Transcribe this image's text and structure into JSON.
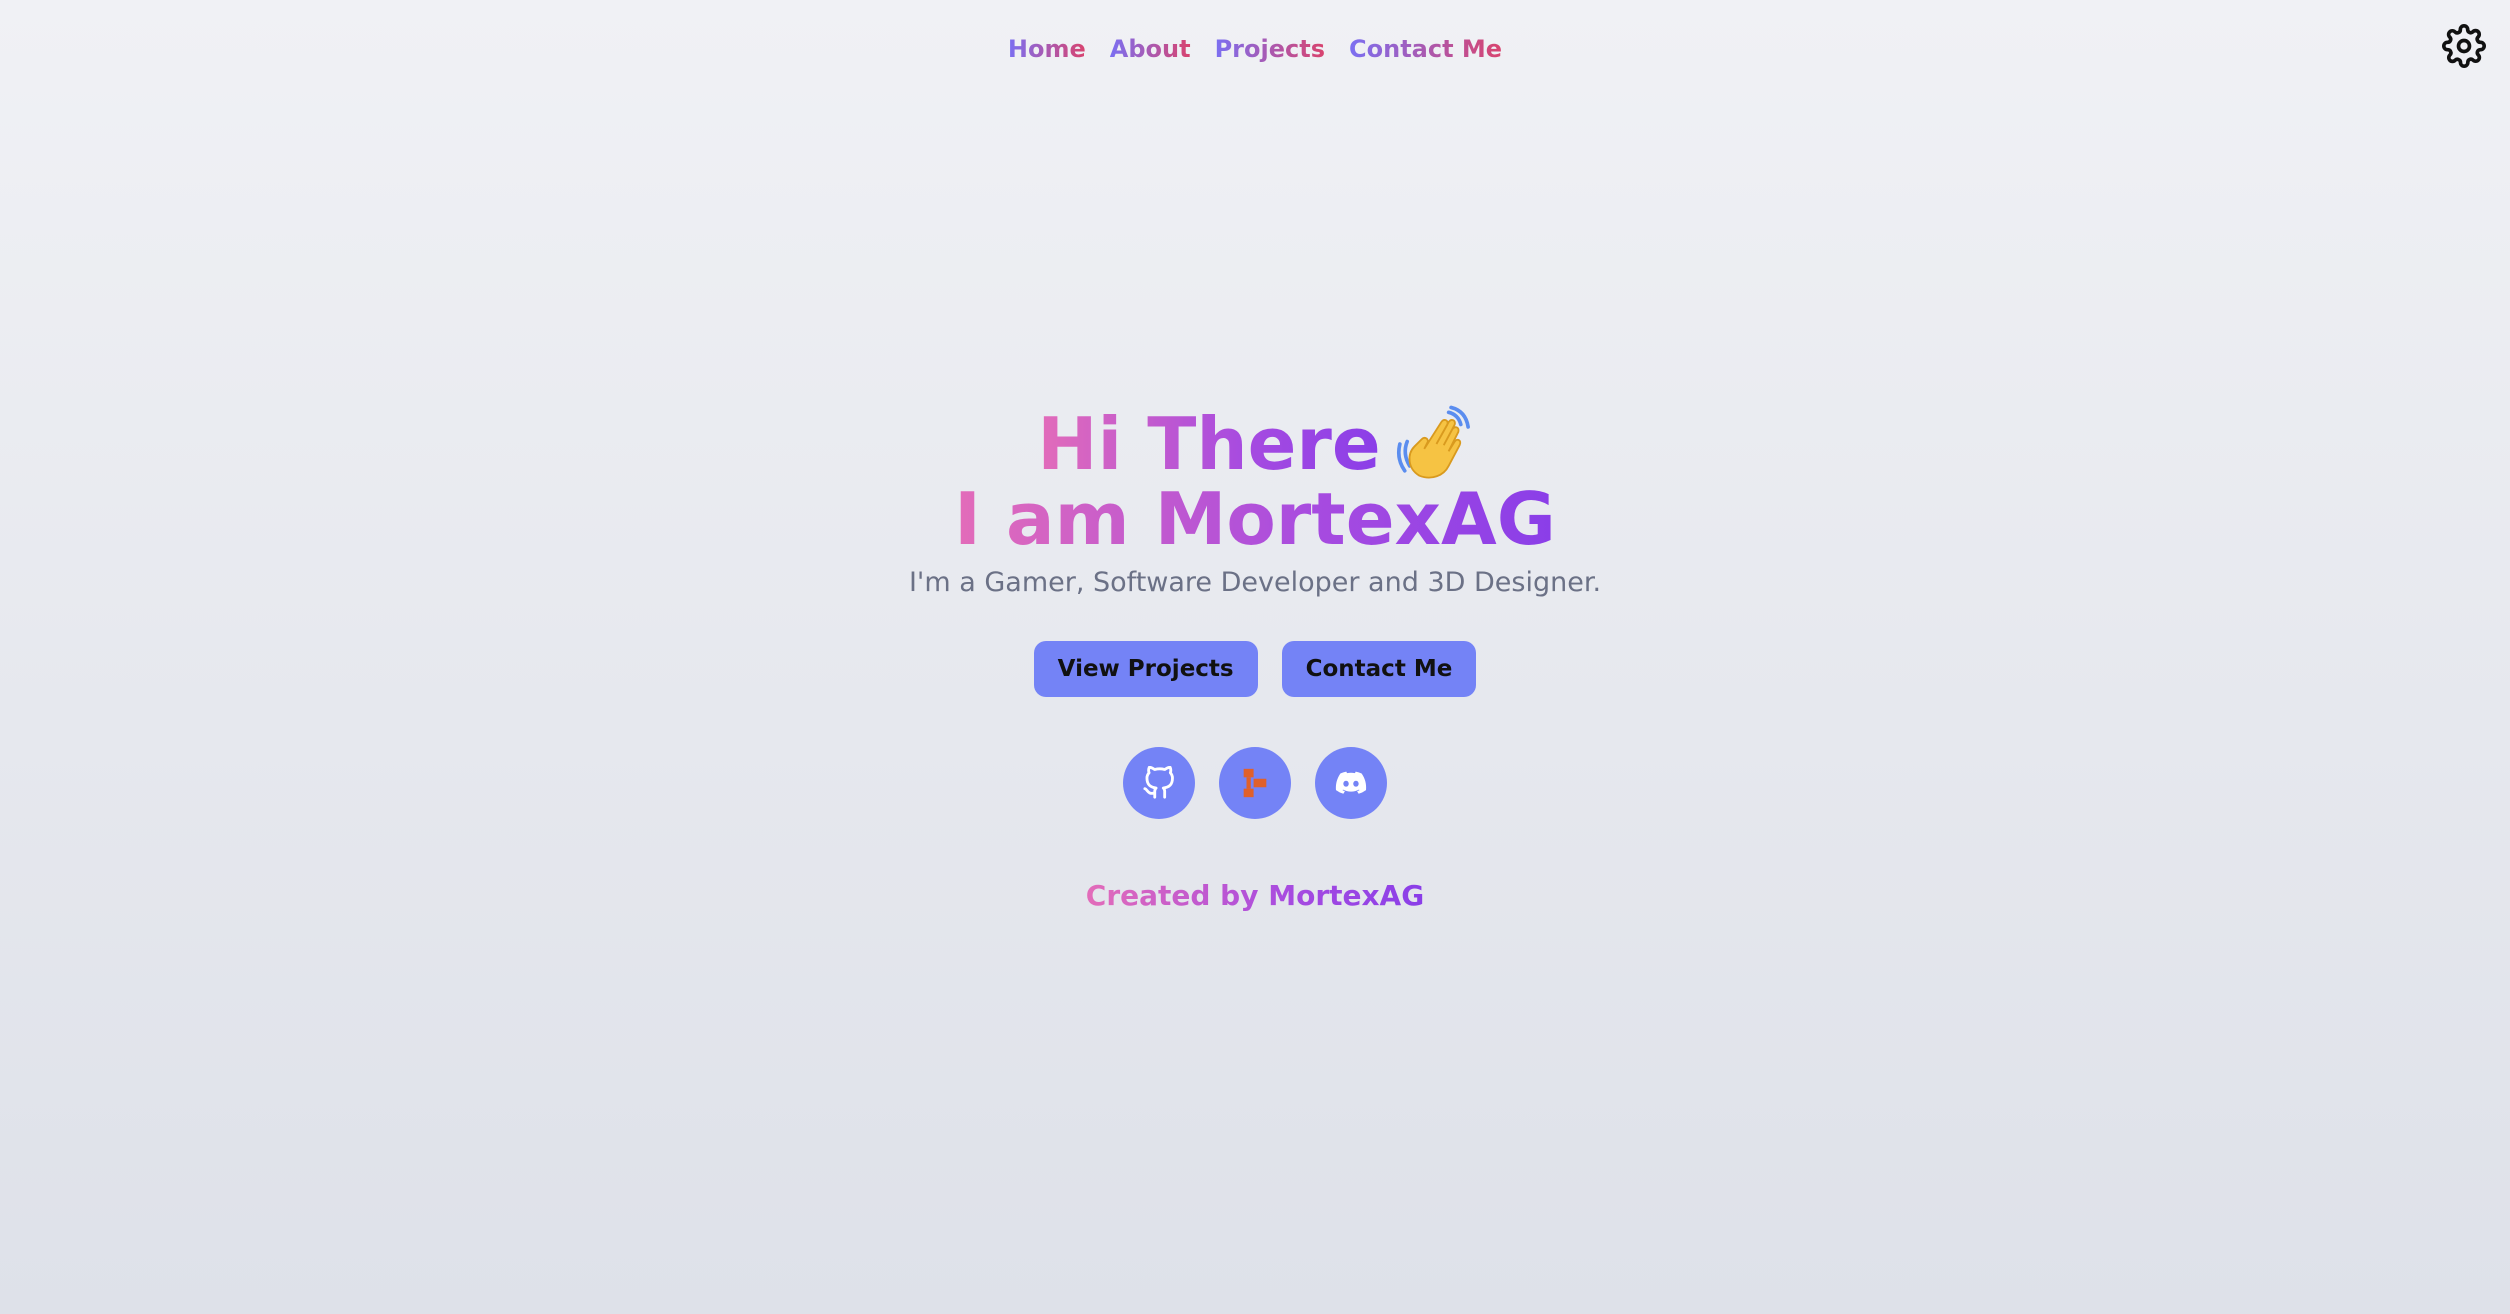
{
  "nav": {
    "items": [
      {
        "label": "Home"
      },
      {
        "label": "About"
      },
      {
        "label": "Projects"
      },
      {
        "label": "Contact Me"
      }
    ]
  },
  "hero": {
    "greeting": "Hi There",
    "wave_icon": "waving-hand-icon",
    "name_line": "I am MortexAG",
    "tagline": "I'm a Gamer, Software Developer and 3D Designer."
  },
  "buttons": {
    "view_projects": "View Projects",
    "contact_me": "Contact Me"
  },
  "socials": [
    {
      "icon": "github-icon"
    },
    {
      "icon": "gitea-icon"
    },
    {
      "icon": "discord-icon"
    }
  ],
  "footer": {
    "credit": "Created by MortexAG"
  },
  "colors": {
    "accent": "#7483f6",
    "gradient_start": "#e36cb9",
    "gradient_end": "#8a3ee8",
    "nav_gradient_start": "#7b6ff2",
    "nav_gradient_end": "#d9436e"
  },
  "settings_icon": "gear-icon"
}
